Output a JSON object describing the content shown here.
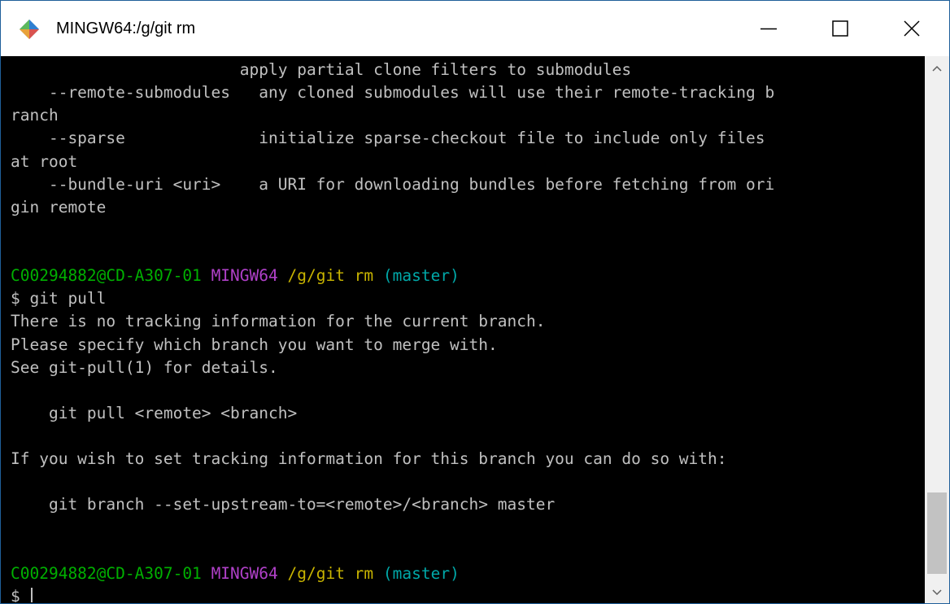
{
  "window": {
    "title": "MINGW64:/g/git rm"
  },
  "icons": {
    "app": "git-for-windows-icon",
    "minimize": "minimize-icon",
    "maximize": "maximize-icon",
    "close": "close-icon",
    "scroll_up": "chevron-up-icon",
    "scroll_down": "chevron-down-icon"
  },
  "colors": {
    "prompt_user": "#00b000",
    "prompt_env": "#b040c8",
    "prompt_path": "#c8b400",
    "prompt_branch": "#00a8a8",
    "text": "#c0c0c0",
    "background": "#000000"
  },
  "terminal": {
    "lines": [
      "                        apply partial clone filters to submodules",
      "    --remote-submodules   any cloned submodules will use their remote-tracking b",
      "ranch",
      "    --sparse              initialize sparse-checkout file to include only files",
      "at root",
      "    --bundle-uri <uri>    a URI for downloading bundles before fetching from ori",
      "gin remote",
      "",
      "",
      {
        "prompt": {
          "user": "C00294882@CD-A307-01",
          "env": "MINGW64",
          "path": "/g/git rm",
          "branch": "(master)"
        }
      },
      "$ git pull",
      "There is no tracking information for the current branch.",
      "Please specify which branch you want to merge with.",
      "See git-pull(1) for details.",
      "",
      "    git pull <remote> <branch>",
      "",
      "If you wish to set tracking information for this branch you can do so with:",
      "",
      "    git branch --set-upstream-to=<remote>/<branch> master",
      "",
      "",
      {
        "prompt": {
          "user": "C00294882@CD-A307-01",
          "env": "MINGW64",
          "path": "/g/git rm",
          "branch": "(master)"
        }
      },
      {
        "input": "$ "
      }
    ]
  }
}
